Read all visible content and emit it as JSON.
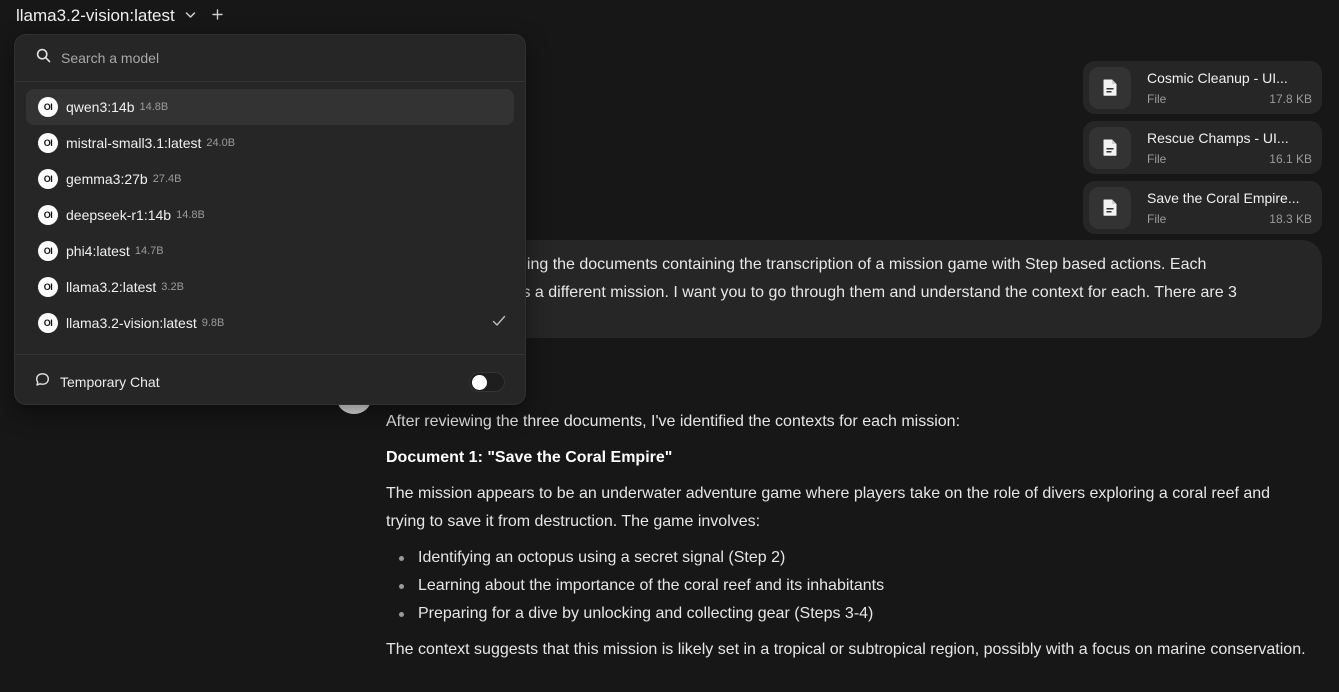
{
  "header": {
    "model_name": "llama3.2-vision:latest",
    "chevron_icon": "chevron-down-icon",
    "plus_icon": "plus-icon"
  },
  "dropdown": {
    "search_placeholder": "Search a model",
    "models": [
      {
        "name": "qwen3:14b",
        "size": "14.8B",
        "active": true,
        "selected": false
      },
      {
        "name": "mistral-small3.1:latest",
        "size": "24.0B",
        "active": false,
        "selected": false
      },
      {
        "name": "gemma3:27b",
        "size": "27.4B",
        "active": false,
        "selected": false
      },
      {
        "name": "deepseek-r1:14b",
        "size": "14.8B",
        "active": false,
        "selected": false
      },
      {
        "name": "phi4:latest",
        "size": "14.7B",
        "active": false,
        "selected": false
      },
      {
        "name": "llama3.2:latest",
        "size": "3.2B",
        "active": false,
        "selected": false
      },
      {
        "name": "llama3.2-vision:latest",
        "size": "9.8B",
        "active": false,
        "selected": true
      }
    ],
    "badge_text": "OI",
    "temporary_chat_label": "Temporary Chat",
    "temporary_chat_enabled": false
  },
  "attachments": [
    {
      "name": "Cosmic Cleanup - UI...",
      "type": "File",
      "size": "17.8 KB"
    },
    {
      "name": "Rescue Champs - UI...",
      "type": "File",
      "size": "16.1 KB"
    },
    {
      "name": "Save the Coral Empire...",
      "type": "File",
      "size": "18.3 KB"
    }
  ],
  "user_message": {
    "line1": "ching the documents containing the transcription of a mission game with Step based actions. Each",
    "line2": "t is a different mission. I want you to go through them and understand the context for each. There are 3"
  },
  "assistant": {
    "intro": "After reviewing the three documents, I've identified the contexts for each mission:",
    "doc_heading": "Document 1: \"Save the Coral Empire\"",
    "paragraph1": "The mission appears to be an underwater adventure game where players take on the role of divers exploring a coral reef and trying to save it from destruction. The game involves:",
    "bullets": [
      "Identifying an octopus using a secret signal (Step 2)",
      "Learning about the importance of the coral reef and its inhabitants",
      "Preparing for a dive by unlocking and collecting gear (Steps 3-4)"
    ],
    "paragraph2": "The context suggests that this mission is likely set in a tropical or subtropical region, possibly with a focus on marine conservation."
  },
  "colors": {
    "background": "#171717",
    "panel": "#262626",
    "text": "#ececec",
    "muted": "#9b9b9b"
  }
}
